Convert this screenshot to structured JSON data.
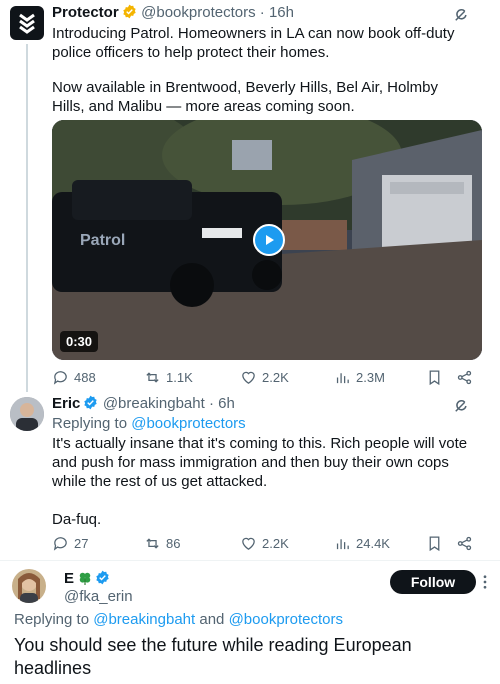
{
  "tweet1": {
    "author_name": "Protector",
    "handle": "@bookprotectors",
    "time": "16h",
    "paragraph1": "Introducing Patrol. Homeowners in LA can now book off-duty police officers to help protect their homes.",
    "paragraph2": "Now available in Brentwood, Beverly Hills, Bel Air, Holmby Hills, and Malibu — more areas coming soon.",
    "video": {
      "duration": "0:30",
      "vehicle_text": "Patrol"
    },
    "stats": {
      "replies": "488",
      "retweets": "1.1K",
      "likes": "2.2K",
      "views": "2.3M"
    }
  },
  "tweet2": {
    "author_name": "Eric",
    "handle": "@breakingbaht",
    "time": "6h",
    "replying_prefix": "Replying to",
    "replying_to": "@bookprotectors",
    "paragraph1": "It's actually insane that it's coming to this. Rich people will vote and push for mass immigration and then buy their own cops while the rest of us get attacked.",
    "paragraph2": "Da-fuq.",
    "stats": {
      "replies": "27",
      "retweets": "86",
      "likes": "2.2K",
      "views": "24.4K"
    }
  },
  "tweet3": {
    "author_name": "E",
    "handle": "@fka_erin",
    "follow_label": "Follow",
    "replying_prefix": "Replying to",
    "replying_to_1": "@breakingbaht",
    "replying_and": "and",
    "replying_to_2": "@bookprotectors",
    "text": "You should see the future while reading European headlines"
  },
  "colors": {
    "accent": "#1d9bf0",
    "verified_badge": "#f4b400",
    "verified_blue": "#1d9bf0",
    "muted": "#536471"
  }
}
